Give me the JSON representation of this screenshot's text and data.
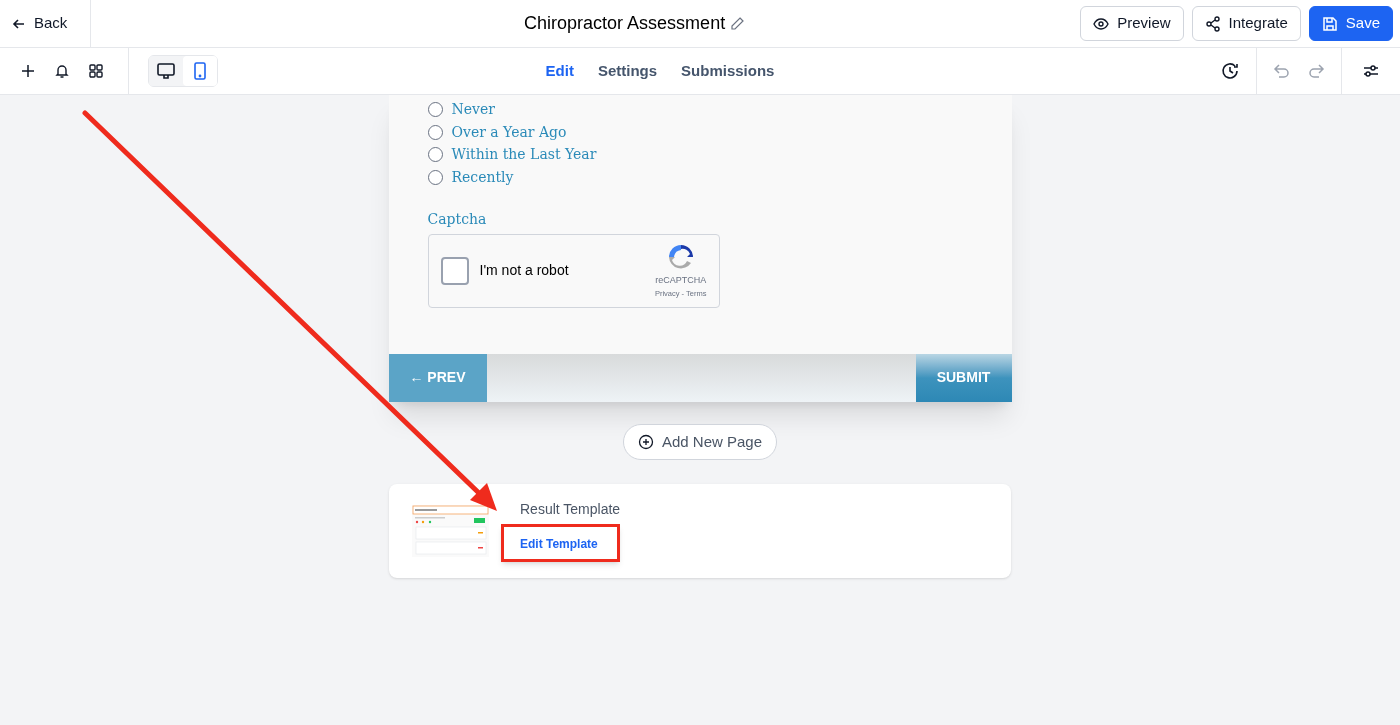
{
  "header": {
    "back": "Back",
    "title": "Chiropractor Assessment",
    "buttons": [
      {
        "label": "Preview",
        "kind": "preview"
      },
      {
        "label": "Integrate",
        "kind": "integrate"
      },
      {
        "label": "Save",
        "kind": "save"
      }
    ]
  },
  "toolbar": {
    "devices": [
      {
        "kind": "desktop",
        "selected": false
      },
      {
        "kind": "mobile",
        "selected": true
      }
    ],
    "tabs": [
      {
        "label": "Edit",
        "selected": true
      },
      {
        "label": "Settings",
        "selected": false
      },
      {
        "label": "Submissions",
        "selected": false
      }
    ]
  },
  "form": {
    "options": [
      {
        "label": "Never",
        "selected": false
      },
      {
        "label": "Over a Year Ago",
        "selected": false
      },
      {
        "label": "Within the Last Year",
        "selected": false
      },
      {
        "label": "Recently",
        "selected": false
      }
    ],
    "captcha_label": "Captcha",
    "recaptcha": {
      "checkbox_label": "I'm not a robot",
      "checked": false,
      "brand": "reCAPTCHA",
      "links": "Privacy - Terms"
    },
    "prev": "← PREV",
    "submit": "SUBMIT"
  },
  "add_page": "Add New Page",
  "result": {
    "title": "Result Template",
    "link": "Edit Template"
  }
}
